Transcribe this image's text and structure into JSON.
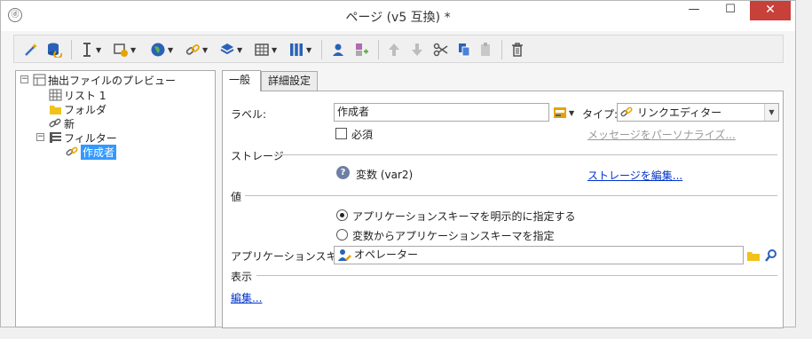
{
  "window": {
    "title": "ページ (v5 互換) *",
    "app_icon": "ⓓ",
    "minimize": "—",
    "maximize": "☐",
    "close": "✕"
  },
  "tree": {
    "root": {
      "label": "抽出ファイルのプレビュー",
      "icon": "grid-icon",
      "expander": "−"
    },
    "items": [
      {
        "label": "リスト 1",
        "icon": "table-icon"
      },
      {
        "label": "フォルダ",
        "icon": "folder-icon"
      },
      {
        "label": "新",
        "icon": "link-icon"
      },
      {
        "label": "フィルター",
        "icon": "filter-icon",
        "expander": "−"
      }
    ],
    "selected": {
      "label": "作成者",
      "icon": "link-edit-icon"
    }
  },
  "tabs": [
    {
      "label": "一般"
    },
    {
      "label": "詳細設定"
    }
  ],
  "form": {
    "label_caption": "ラベル:",
    "label_value": "作成者",
    "type_caption": "タイプ:",
    "type_value": "リンクエディター",
    "required_label": "必須",
    "customize_message": "メッセージをパーソナライズ...",
    "storage_section": "ストレージ",
    "storage_value": "変数 (var2)",
    "storage_edit": "ストレージを編集...",
    "value_section": "値",
    "radio_explicit": "アプリケーションスキーマを明示的に指定する",
    "radio_variable": "変数からアプリケーションスキーマを指定",
    "schema_caption": "アプリケーションスキーマ:",
    "schema_value": "オペレーター",
    "display_section": "表示",
    "edit_link": "編集..."
  },
  "colors": {
    "selection": "#3399ff",
    "link": "#0033cc",
    "close_button": "#c7403a"
  }
}
